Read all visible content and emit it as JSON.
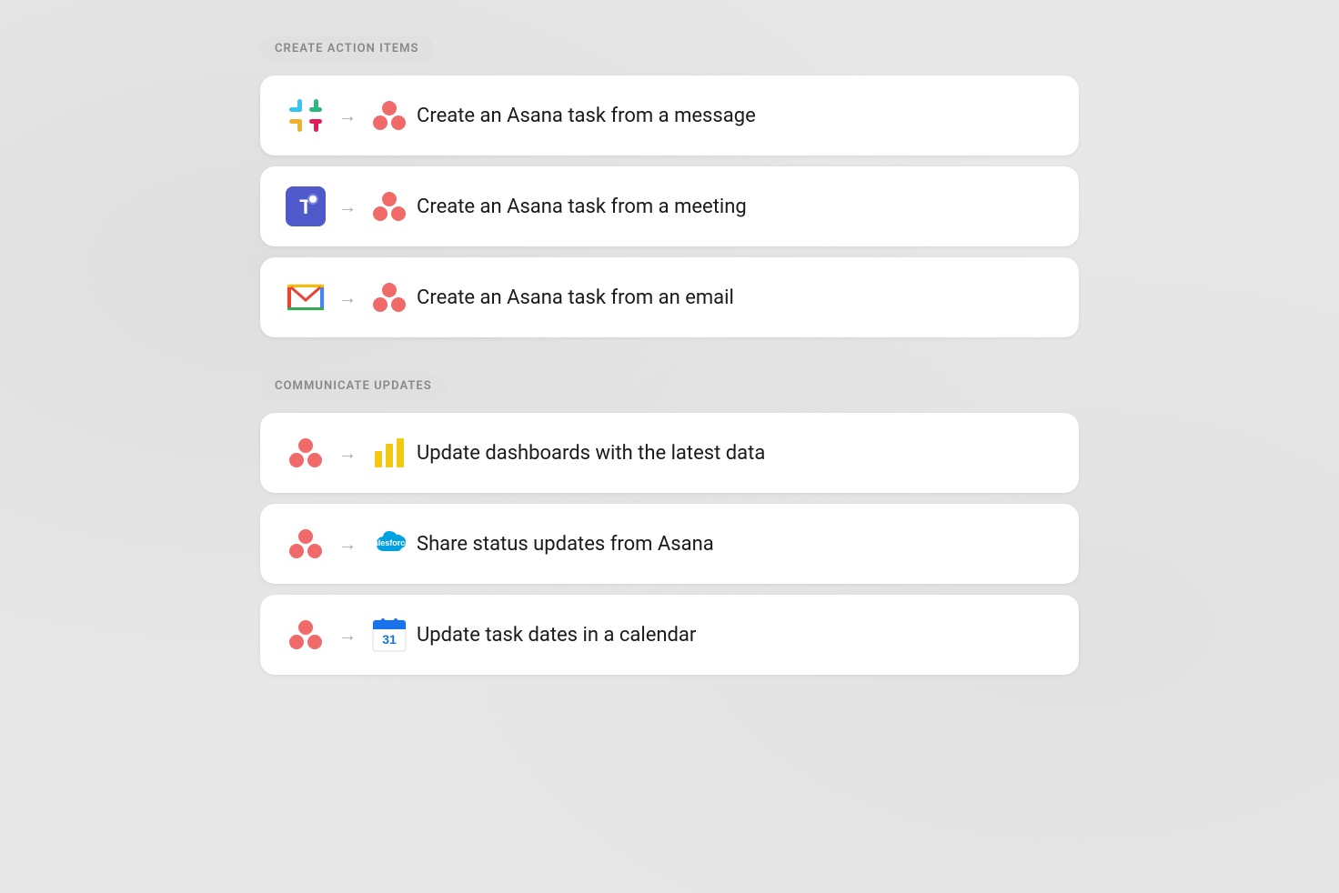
{
  "sections": [
    {
      "id": "create-action-items",
      "label": "CREATE ACTION ITEMS",
      "cards": [
        {
          "id": "slack-to-asana",
          "text": "Create an Asana task from a message",
          "source_icon": "slack",
          "dest_icon": "asana"
        },
        {
          "id": "teams-to-asana",
          "text": "Create an Asana task from a meeting",
          "source_icon": "teams",
          "dest_icon": "asana"
        },
        {
          "id": "gmail-to-asana",
          "text": "Create an Asana task from an email",
          "source_icon": "gmail",
          "dest_icon": "asana"
        }
      ]
    },
    {
      "id": "communicate-updates",
      "label": "COMMUNICATE UPDATES",
      "cards": [
        {
          "id": "asana-to-powerbi",
          "text": "Update dashboards with the latest data",
          "source_icon": "asana",
          "dest_icon": "powerbi"
        },
        {
          "id": "asana-to-salesforce",
          "text": "Share status updates from Asana",
          "source_icon": "asana",
          "dest_icon": "salesforce"
        },
        {
          "id": "asana-to-gcal",
          "text": "Update task dates in a calendar",
          "source_icon": "asana",
          "dest_icon": "gcal"
        }
      ]
    }
  ]
}
